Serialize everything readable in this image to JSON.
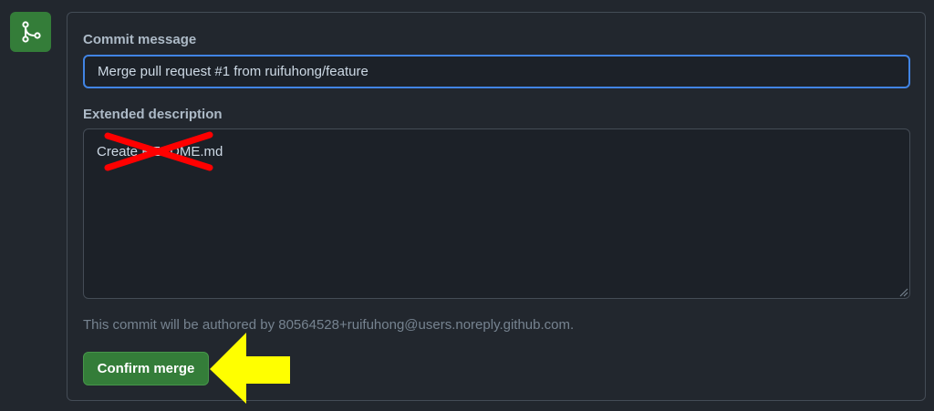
{
  "merge_form": {
    "commit_message_label": "Commit message",
    "commit_message_value": "Merge pull request #1 from ruifuhong/feature",
    "extended_description_label": "Extended description",
    "extended_description_value": "Create README.md",
    "author_note": "This commit will be authored by 80564528+ruifuhong@users.noreply.github.com.",
    "confirm_button_label": "Confirm merge"
  },
  "icons": {
    "merge_badge": "git-merge-icon",
    "resize": "resize-handle-icon",
    "annotation_arrow": "left-arrow-icon",
    "redaction": "red-x-redaction-mark"
  },
  "colors": {
    "background": "#22272e",
    "input_background": "#1c2128",
    "border": "#444c56",
    "focus_border": "#4184e4",
    "success": "#347d39",
    "annotation_arrow": "#ffff00",
    "redaction": "#ff0000"
  }
}
